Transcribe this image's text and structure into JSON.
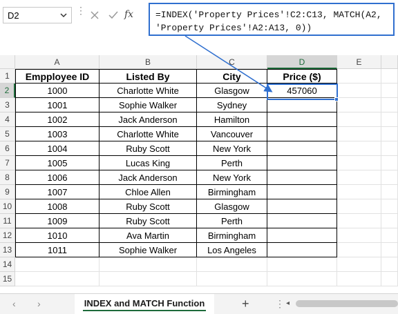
{
  "formula_bar": {
    "name_box": "D2",
    "fx_label": "fx",
    "formula_line1": "=INDEX('Property Prices'!C2:C13, MATCH(A2,",
    "formula_line2": "'Property Prices'!A2:A13, 0))"
  },
  "columns": [
    "A",
    "B",
    "C",
    "D",
    "E"
  ],
  "rows": [
    "1",
    "2",
    "3",
    "4",
    "5",
    "6",
    "7",
    "8",
    "9",
    "10",
    "11",
    "12",
    "13",
    "14",
    "15"
  ],
  "table": {
    "headers": [
      "Empployee ID",
      "Listed By",
      "City",
      "Price ($)"
    ],
    "rows": [
      [
        "1000",
        "Charlotte White",
        "Glasgow",
        "457060"
      ],
      [
        "1001",
        "Sophie Walker",
        "Sydney",
        ""
      ],
      [
        "1002",
        "Jack Anderson",
        "Hamilton",
        ""
      ],
      [
        "1003",
        "Charlotte White",
        "Vancouver",
        ""
      ],
      [
        "1004",
        "Ruby Scott",
        "New York",
        ""
      ],
      [
        "1005",
        "Lucas King",
        "Perth",
        ""
      ],
      [
        "1006",
        "Jack Anderson",
        "New York",
        ""
      ],
      [
        "1007",
        "Chloe Allen",
        "Birmingham",
        ""
      ],
      [
        "1008",
        "Ruby Scott",
        "Glasgow",
        ""
      ],
      [
        "1009",
        "Ruby Scott",
        "Perth",
        ""
      ],
      [
        "1010",
        "Ava Martin",
        "Birmingham",
        ""
      ],
      [
        "1011",
        "Sophie Walker",
        "Los Angeles",
        ""
      ]
    ]
  },
  "sheet_tabs": {
    "active": "INDEX and MATCH Function",
    "prev_icon": "‹",
    "next_icon": "›",
    "add_icon": "+",
    "more_icon": "⋮",
    "scroll_left_icon": "◂"
  },
  "colors": {
    "accent_blue": "#2f6fcf",
    "excel_green": "#1d6b3a"
  }
}
